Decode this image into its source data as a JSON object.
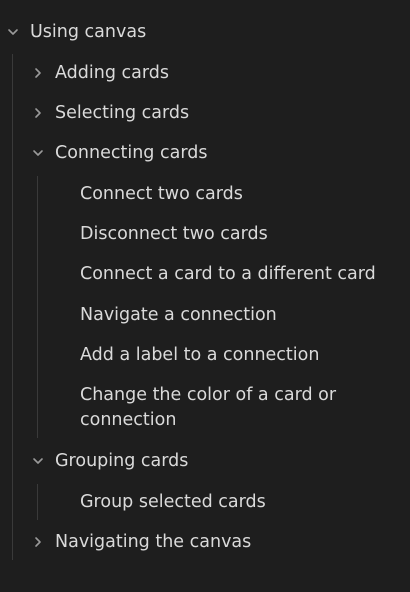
{
  "tree": {
    "root": {
      "label": "Using canvas",
      "expanded": true
    },
    "sections": [
      {
        "label": "Adding cards",
        "expanded": false
      },
      {
        "label": "Selecting cards",
        "expanded": false
      },
      {
        "label": "Connecting cards",
        "expanded": true,
        "items": [
          "Connect two cards",
          "Disconnect two cards",
          "Connect a card to a different card",
          "Navigate a connection",
          "Add a label to a connection",
          "Change the color of a card or connection"
        ]
      },
      {
        "label": "Grouping cards",
        "expanded": true,
        "items": [
          "Group selected cards"
        ]
      },
      {
        "label": "Navigating the canvas",
        "expanded": false
      }
    ]
  },
  "colors": {
    "background": "#1e1e1e",
    "text": "#dadada",
    "guide": "#3a3a3a",
    "chevron": "#9a9a9a"
  },
  "icons": {
    "expanded": "chevron-down-icon",
    "collapsed": "chevron-right-icon"
  }
}
